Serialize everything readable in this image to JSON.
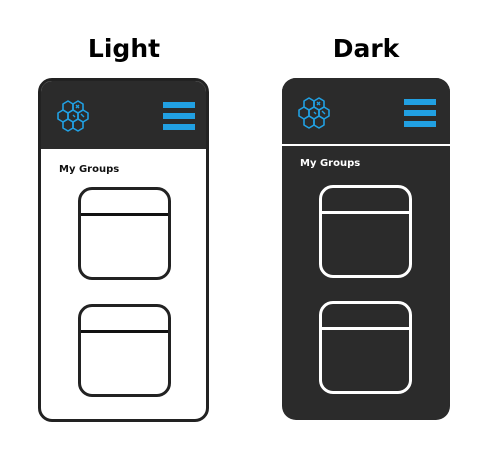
{
  "variants": {
    "light": {
      "title": "Light",
      "section_title": "My Groups",
      "groups": [
        {},
        {}
      ]
    },
    "dark": {
      "title": "Dark",
      "section_title": "My Groups",
      "groups": [
        {},
        {}
      ]
    }
  },
  "icons": {
    "logo": "hexagon-cluster-logo-icon",
    "menu": "hamburger-menu-icon"
  },
  "colors": {
    "accent": "#21a0e2",
    "header_bg": "#2b2b2b",
    "dark_bg": "#2b2b2b",
    "light_bg": "#ffffff",
    "outline_light": "#222222",
    "outline_dark": "#ffffff"
  }
}
